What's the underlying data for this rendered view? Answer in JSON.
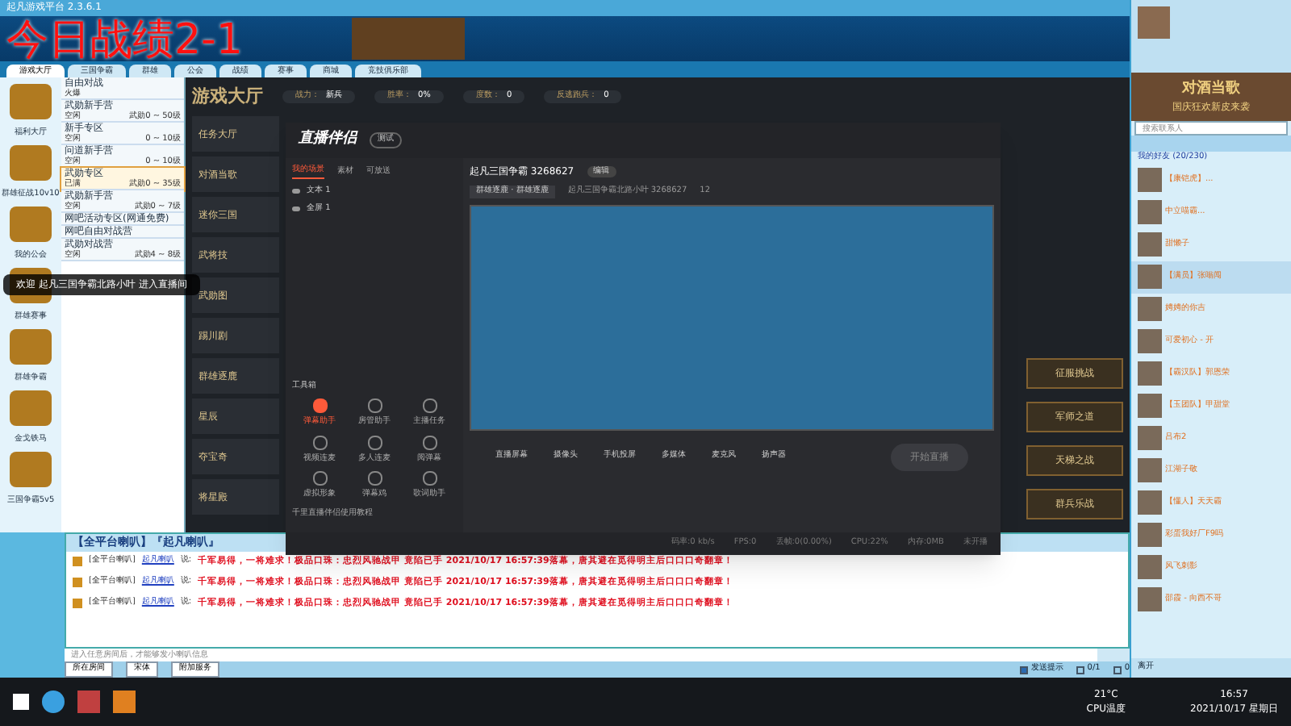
{
  "overlay_text": "今日战绩2-1",
  "window": {
    "title": "起凡游戏平台 2.3.6.1"
  },
  "nav_tabs": [
    {
      "label": "游戏大厅",
      "selected": true
    },
    {
      "label": "三国争霸",
      "selected": false
    },
    {
      "label": "群雄",
      "selected": false
    },
    {
      "label": "公会",
      "selected": false
    },
    {
      "label": "战绩",
      "selected": false
    },
    {
      "label": "赛事",
      "selected": false
    },
    {
      "label": "商城",
      "selected": false
    },
    {
      "label": "竞技俱乐部",
      "selected": false
    }
  ],
  "sidebar": [
    {
      "label": "福利大厅"
    },
    {
      "label": "群雄征战10v10"
    },
    {
      "label": "我的公会"
    },
    {
      "label": "群雄赛事"
    },
    {
      "label": "群雄争霸"
    },
    {
      "label": "金戈铁马"
    },
    {
      "label": "三国争霸5v5"
    }
  ],
  "rooms": [
    {
      "name": "自由对战",
      "status": "火爆",
      "selected": false
    },
    {
      "name": "武勋新手营",
      "status": "空闲",
      "level": "武勋0 ~ 50级",
      "selected": false
    },
    {
      "name": "新手专区",
      "status": "空闲",
      "level": "0 ~ 10级",
      "selected": false
    },
    {
      "name": "问道新手营",
      "status": "空闲",
      "level": "0 ~ 10级",
      "selected": false
    },
    {
      "name": "武勋专区",
      "status": "已满",
      "level": "武勋0 ~ 35级",
      "selected": true
    },
    {
      "name": "武勋新手营",
      "status": "空闲",
      "level": "武勋0 ~ 7级",
      "selected": false
    },
    {
      "name": "网吧活动专区(网通免费)",
      "selected": false
    },
    {
      "name": "网吧自由对战营",
      "selected": false
    },
    {
      "name": "武勋对战营",
      "status": "空闲",
      "level": "武勋4 ~ 8级",
      "selected": false
    }
  ],
  "notice": "欢迎 起凡三国争霸北路小叶 进入直播间",
  "lobby": {
    "title": "游戏大厅",
    "fields": [
      {
        "label": "战力：",
        "value": "新兵"
      },
      {
        "label": "胜率：",
        "value": "0%"
      },
      {
        "label": "度数：",
        "value": "0"
      },
      {
        "label": "反逃跑兵：",
        "value": "0"
      }
    ],
    "menu": [
      "任务大厅",
      "对酒当歌",
      "迷你三国",
      "武将技",
      "武勋图",
      "踢川剧",
      "群雄逐鹿",
      "星辰",
      "夺宝奇",
      "将星殿"
    ],
    "side_buttons": [
      "征服挑战",
      "军师之道",
      "天梯之战",
      "群兵乐战"
    ]
  },
  "streamer": {
    "app": "直播伴侣",
    "beta": "测试",
    "scene_tabs": [
      {
        "label": "我的场景",
        "selected": true
      },
      {
        "label": "素材",
        "selected": false
      },
      {
        "label": "可放送",
        "selected": false
      }
    ],
    "sources": [
      "文本 1",
      "全屏 1"
    ],
    "room_title": "起凡三国争霸 3268627",
    "room_tag": "编辑",
    "category": "群雄逐鹿 · 群雄逐鹿",
    "room_sub": "起凡三国争霸北路小叶 3268627",
    "viewers": "12",
    "toolbox_title": "工具箱",
    "tools": [
      {
        "label": "弹幕助手",
        "active": true
      },
      {
        "label": "房管助手",
        "active": false
      },
      {
        "label": "主播任务",
        "active": false
      },
      {
        "label": "视频连麦",
        "active": false
      },
      {
        "label": "多人连麦",
        "active": false
      },
      {
        "label": "阅弹幕",
        "active": false
      },
      {
        "label": "虚拟形象",
        "active": false
      },
      {
        "label": "弹幕鸡",
        "active": false
      },
      {
        "label": "歌词助手",
        "active": false
      }
    ],
    "tool_hint": "千里直播伴侣使用教程",
    "controls": [
      "直播屏幕",
      "摄像头",
      "手机投屏",
      "多媒体",
      "麦克风",
      "扬声器"
    ],
    "start": "开始直播",
    "stats": [
      "码率:0 kb/s",
      "FPS:0",
      "丢帧:0(0.00%)",
      "CPU:22%",
      "内存:0MB",
      "未开播"
    ]
  },
  "chat": {
    "header": "【全平台喇叭】『起凡喇叭』",
    "lines": [
      {
        "channel": "[全平台喇叭]",
        "user": "起凡喇叭",
        "said": "说:",
        "text": "千军易得，一将难求！极品口珠：忠烈风驰战甲 竟陷已手 2021/10/17 16:57:39落幕，唐其避在觅得明主后口口口奇翻章！"
      },
      {
        "channel": "[全平台喇叭]",
        "user": "起凡喇叭",
        "said": "说:",
        "text": "千军易得，一将难求！极品口珠：忠烈风驰战甲 竟陷已手 2021/10/17 16:57:39落幕，唐其避在觅得明主后口口口奇翻章！"
      },
      {
        "channel": "[全平台喇叭]",
        "user": "起凡喇叭",
        "said": "说:",
        "text": "千军易得，一将难求！极品口珠：忠烈风驰战甲 竟陷已手 2021/10/17 16:57:39落幕，唐其避在觅得明主后口口口奇翻章！"
      }
    ],
    "input_placeholder": "进入任意房间后，才能够发小喇叭信息",
    "options": [
      "所在房间",
      "宋体",
      "附加服务"
    ],
    "status": [
      {
        "label": "发送提示",
        "checked": true
      },
      {
        "label": "0/1",
        "checked": false
      },
      {
        "label": "0",
        "checked": false
      }
    ]
  },
  "friends": {
    "search_placeholder": "搜索联系人",
    "group": "我的好友 (20/230)",
    "items": [
      {
        "name": "【康铠虎】...",
        "selected": false
      },
      {
        "name": "中立喵霸...",
        "selected": false
      },
      {
        "name": "甜懒子",
        "selected": false
      },
      {
        "name": "【满员】张嗡闯",
        "selected": true
      },
      {
        "name": "娉娉的你吉",
        "selected": false
      },
      {
        "name": "可爱初心 - 开",
        "selected": false
      },
      {
        "name": "【霸汉队】郭恩荣",
        "selected": false
      },
      {
        "name": "【玉团队】甲甜堂",
        "selected": false
      },
      {
        "name": "吕布2",
        "selected": false
      },
      {
        "name": "江湖子敬",
        "selected": false
      },
      {
        "name": "【懂人】天天霸",
        "selected": false
      },
      {
        "name": "彩蛋我好厂F9吗",
        "selected": false
      },
      {
        "name": "风飞刺影",
        "selected": false
      },
      {
        "name": "邵霞 - 向西不哥",
        "selected": false
      }
    ],
    "banner": "对酒当歌",
    "banner_sub": "国庆狂欢新皮来袭",
    "status_label": "离开"
  },
  "taskbar": {
    "temp": "21°C",
    "temp_label": "CPU温度",
    "time": "16:57",
    "date": "2021/10/17 星期日"
  }
}
